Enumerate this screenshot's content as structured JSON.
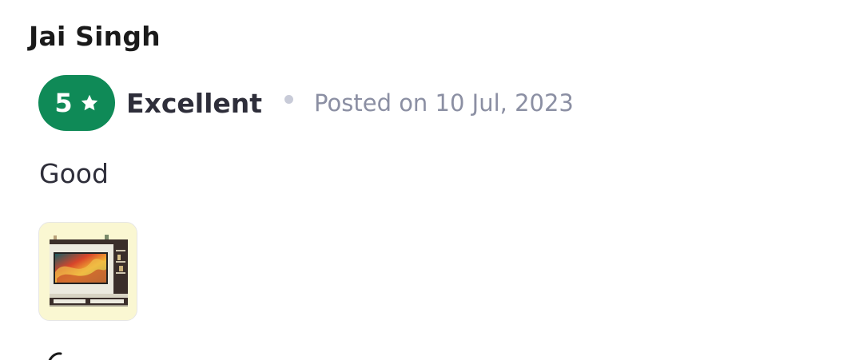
{
  "review": {
    "reviewer_name": "Jai Singh",
    "rating": {
      "value": "5",
      "label": "Excellent",
      "badge_color": "#0f8a57"
    },
    "posted_text": "Posted on 10 Jul, 2023",
    "body": "Good",
    "photos": [
      {
        "icon": "tv-unit-product-photo"
      }
    ]
  }
}
